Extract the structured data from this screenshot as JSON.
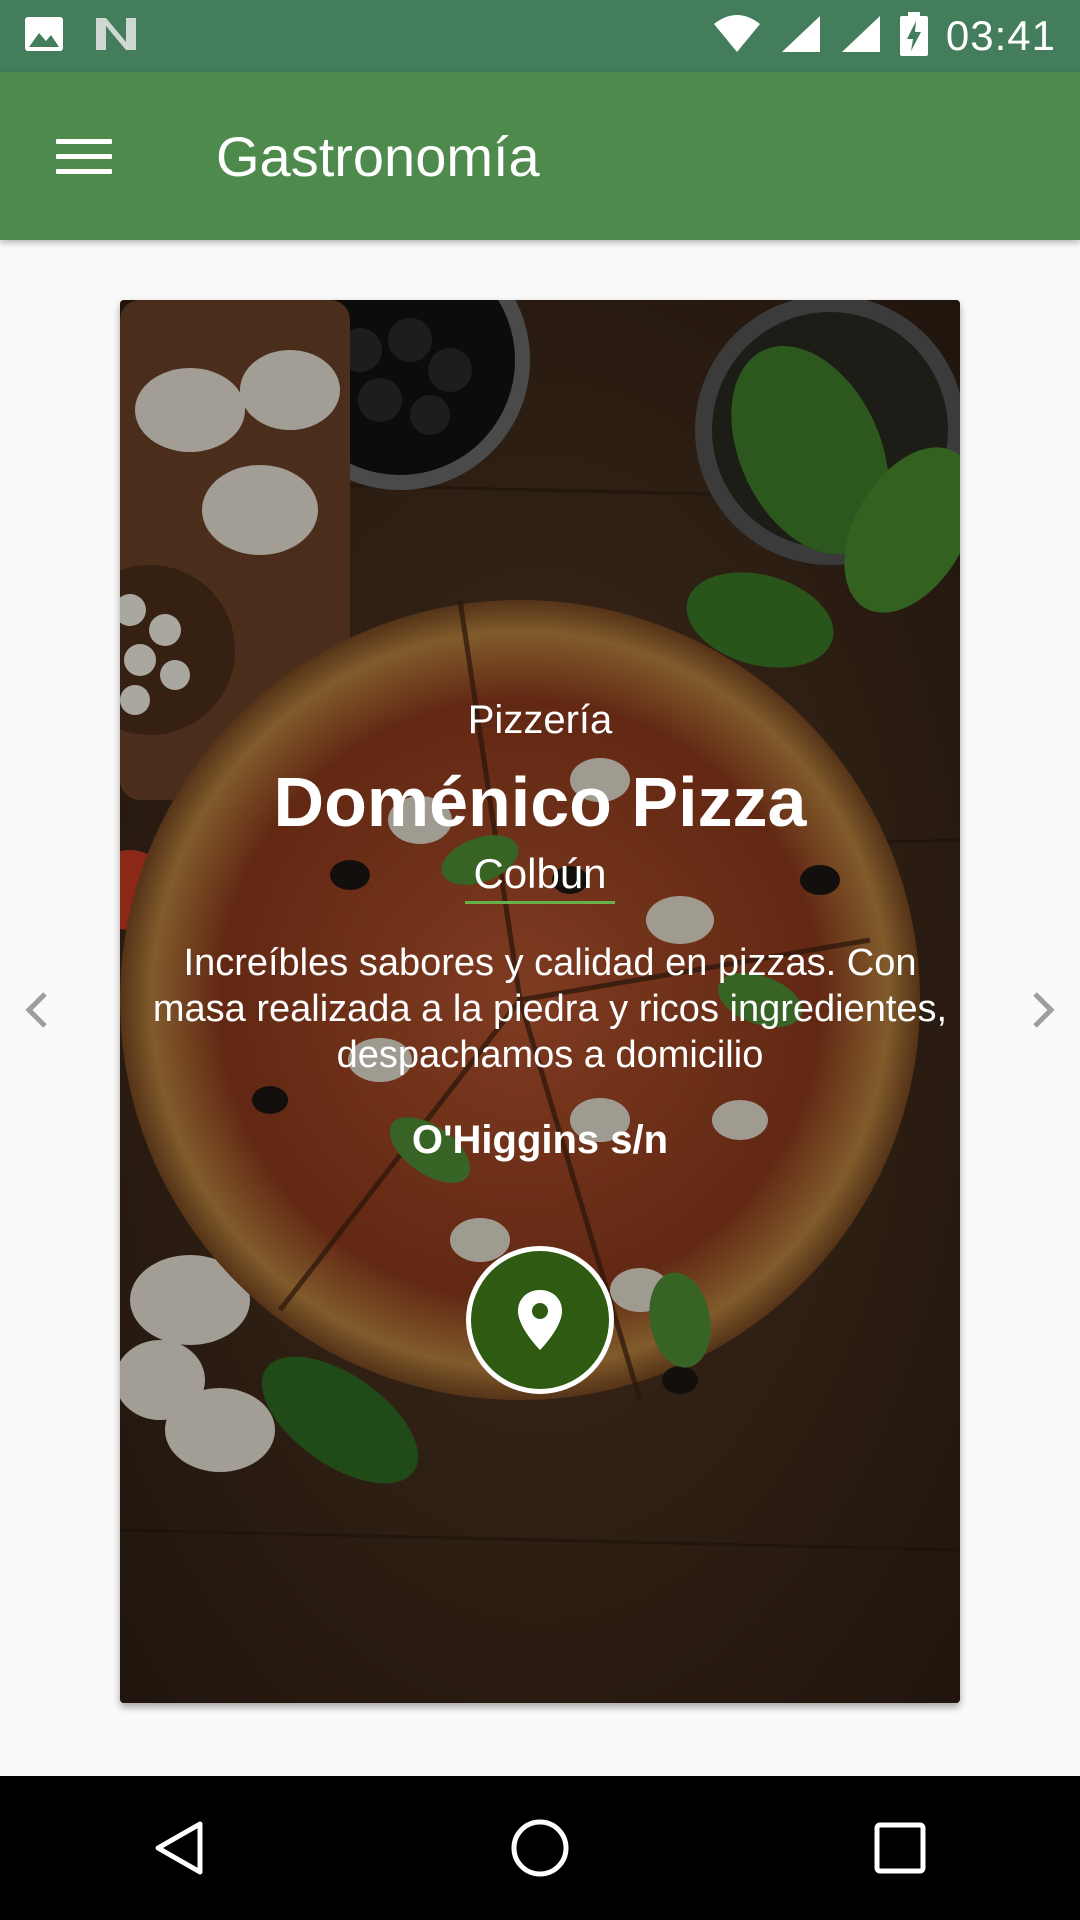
{
  "status_bar": {
    "time": "03:41",
    "icons": [
      "image-icon",
      "n-icon",
      "wifi-icon",
      "signal-icon",
      "signal-icon",
      "battery-charging-icon"
    ]
  },
  "app_bar": {
    "title": "Gastronomía",
    "menu_icon": "menu-icon"
  },
  "card": {
    "category": "Pizzería",
    "name": "Doménico Pizza",
    "city": "Colbún",
    "description": "Increíbles sabores y calidad en pizzas. Con masa realizada a la piedra y ricos ingredientes, despachamos a domicilio",
    "address": "O'Higgins s/n",
    "map_icon": "location-pin-icon"
  },
  "carousel": {
    "prev_icon": "chevron-left-icon",
    "next_icon": "chevron-right-icon"
  },
  "nav_bar": {
    "back_icon": "back-icon",
    "home_icon": "home-icon",
    "recents_icon": "recents-icon"
  },
  "colors": {
    "status_bar": "#437d5c",
    "app_bar": "#4d8a4c",
    "map_button": "#2f5a12",
    "city_underline": "#67b04a"
  }
}
